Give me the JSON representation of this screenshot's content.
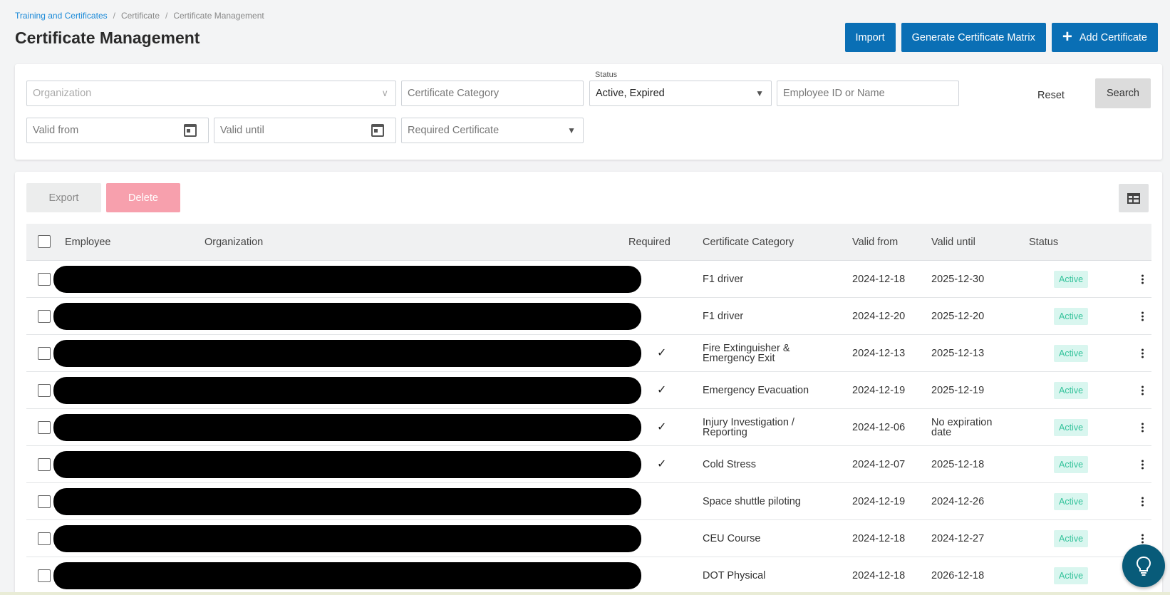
{
  "breadcrumb": {
    "items": [
      "Training and Certificates",
      "Certificate",
      "Certificate Management"
    ],
    "separator": "/"
  },
  "page_title": "Certificate Management",
  "top_actions": {
    "import": "Import",
    "generate_matrix": "Generate Certificate Matrix",
    "add_certificate": "Add Certificate"
  },
  "filters": {
    "organization_placeholder": "Organization",
    "certificate_category_placeholder": "Certificate Category",
    "status_label": "Status",
    "status_value": "Active, Expired",
    "employee_placeholder": "Employee ID or Name",
    "valid_from_placeholder": "Valid from",
    "valid_until_placeholder": "Valid until",
    "required_certificate_placeholder": "Required Certificate",
    "reset": "Reset",
    "search": "Search"
  },
  "table_actions": {
    "export": "Export",
    "delete": "Delete"
  },
  "table": {
    "headers": {
      "employee": "Employee",
      "organization": "Organization",
      "required": "Required",
      "certificate_category": "Certificate Category",
      "valid_from": "Valid from",
      "valid_until": "Valid until",
      "status": "Status"
    },
    "rows": [
      {
        "required": false,
        "category_line1": "F1 driver",
        "category_line2": "",
        "valid_from": "2024-12-18",
        "valid_until_line1": "2025-12-30",
        "valid_until_line2": "",
        "status": "Active"
      },
      {
        "required": false,
        "category_line1": "F1 driver",
        "category_line2": "",
        "valid_from": "2024-12-20",
        "valid_until_line1": "2025-12-20",
        "valid_until_line2": "",
        "status": "Active"
      },
      {
        "required": true,
        "category_line1": "Fire Extinguisher &",
        "category_line2": "Emergency Exit",
        "valid_from": "2024-12-13",
        "valid_until_line1": "2025-12-13",
        "valid_until_line2": "",
        "status": "Active"
      },
      {
        "required": true,
        "category_line1": "Emergency Evacuation",
        "category_line2": "",
        "valid_from": "2024-12-19",
        "valid_until_line1": "2025-12-19",
        "valid_until_line2": "",
        "status": "Active"
      },
      {
        "required": true,
        "category_line1": "Injury Investigation /",
        "category_line2": "Reporting",
        "valid_from": "2024-12-06",
        "valid_until_line1": "No expiration",
        "valid_until_line2": "date",
        "status": "Active"
      },
      {
        "required": true,
        "category_line1": "Cold Stress",
        "category_line2": "",
        "valid_from": "2024-12-07",
        "valid_until_line1": "2025-12-18",
        "valid_until_line2": "",
        "status": "Active"
      },
      {
        "required": false,
        "category_line1": "Space shuttle piloting",
        "category_line2": "",
        "valid_from": "2024-12-19",
        "valid_until_line1": "2024-12-26",
        "valid_until_line2": "",
        "status": "Active"
      },
      {
        "required": false,
        "category_line1": "CEU Course",
        "category_line2": "",
        "valid_from": "2024-12-18",
        "valid_until_line1": "2024-12-27",
        "valid_until_line2": "",
        "status": "Active"
      },
      {
        "required": false,
        "category_line1": "DOT Physical",
        "category_line2": "",
        "valid_from": "2024-12-18",
        "valid_until_line1": "2026-12-18",
        "valid_until_line2": "",
        "status": "Active"
      }
    ]
  },
  "icons": {
    "calendar": "calendar-icon",
    "chevron": "chevron-down-icon",
    "caret": "caret-down-icon",
    "check": "check-icon",
    "kebab": "kebab-menu-icon",
    "table_view": "table-view-icon",
    "plus": "plus-icon",
    "help": "lightbulb-icon"
  },
  "colors": {
    "primary": "#0a6fb5",
    "delete": "#f7a0ad",
    "status_active_bg": "#d9f6ef",
    "status_active_text": "#34c39b",
    "help_fab": "#085b79"
  }
}
